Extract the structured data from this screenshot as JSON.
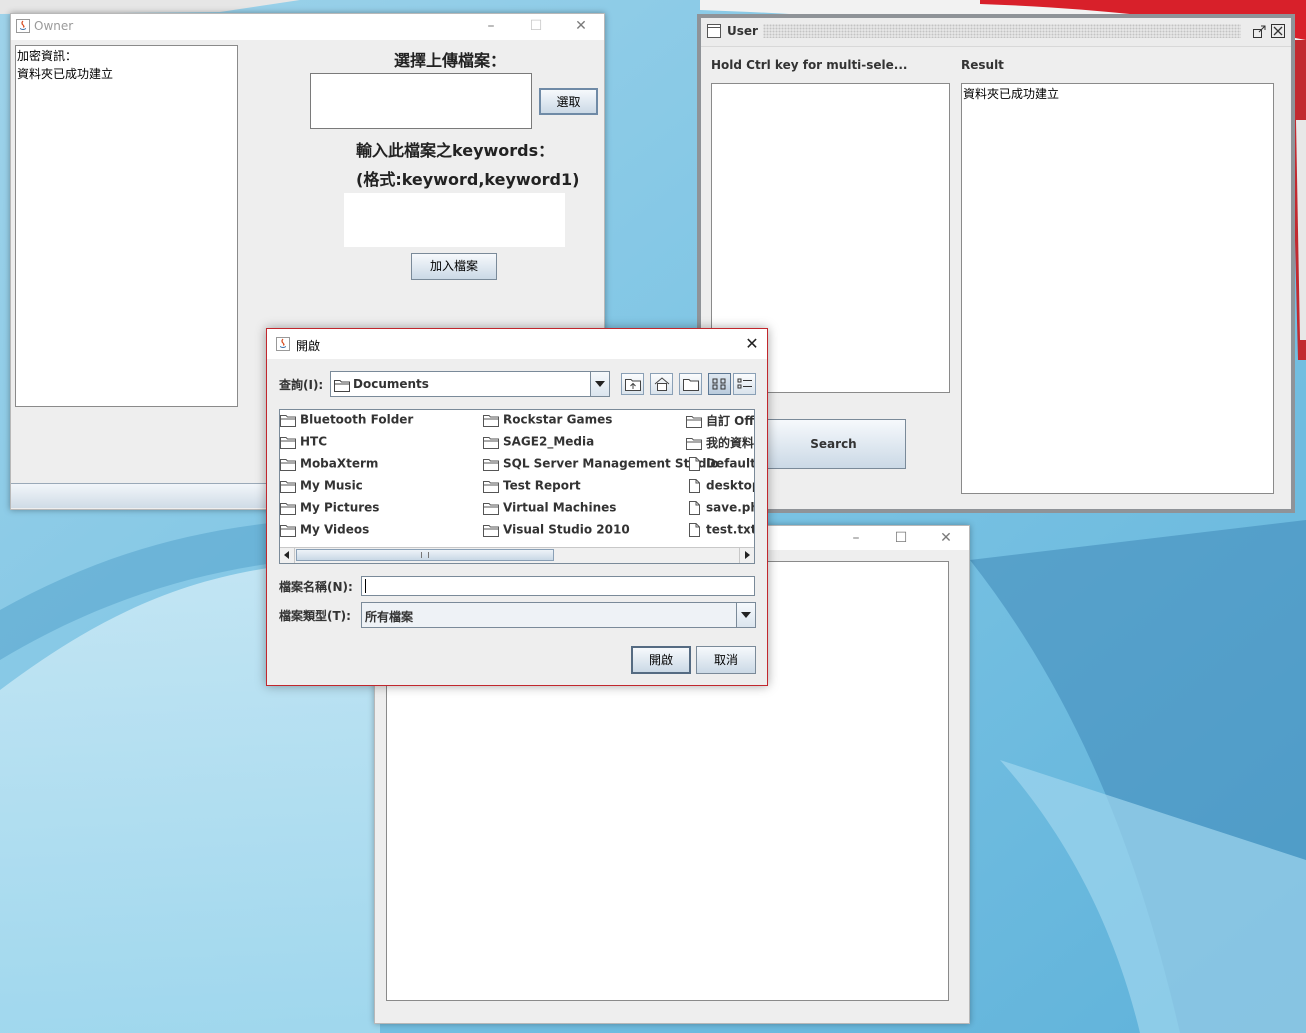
{
  "owner": {
    "title": "Owner",
    "log_lines": [
      "加密資訊：",
      "資料夾已成功建立"
    ],
    "select_file_label": "選擇上傳檔案：",
    "choose_button": "選取",
    "keywords_label": "輸入此檔案之keywords：",
    "keywords_format": "(格式:keyword,keyword1)",
    "add_file_button": "加入檔案"
  },
  "user": {
    "title": "User",
    "multi_select_hint": "Hold Ctrl key for multi-sele...",
    "result_label": "Result",
    "result_text": "資料夾已成功建立",
    "search_button": "Search"
  },
  "dialog": {
    "title": "開啟",
    "look_in_label": "查詢(I):",
    "look_in_value": "Documents",
    "files_col1": [
      "Bluetooth Folder",
      "HTC",
      "MobaXterm",
      "My Music",
      "My Pictures",
      "My Videos"
    ],
    "files_col2": [
      "Rockstar Games",
      "SAGE2_Media",
      "SQL Server Management Studio",
      "Test Report",
      "Virtual Machines",
      "Visual Studio 2010"
    ],
    "files_col3": [
      {
        "name": "自訂 Office",
        "icon": "folder-icon"
      },
      {
        "name": "我的資料來源",
        "icon": "folder-icon"
      },
      {
        "name": "Default.rdp",
        "icon": "file-icon"
      },
      {
        "name": "desktop.ini",
        "icon": "file-icon"
      },
      {
        "name": "save.php",
        "icon": "file-icon"
      },
      {
        "name": "test.txt",
        "icon": "file-icon"
      }
    ],
    "file_name_label": "檔案名稱(N):",
    "file_name_value": "",
    "file_type_label": "檔案類型(T):",
    "file_type_value": "所有檔案",
    "open_button": "開啟",
    "cancel_button": "取消"
  }
}
